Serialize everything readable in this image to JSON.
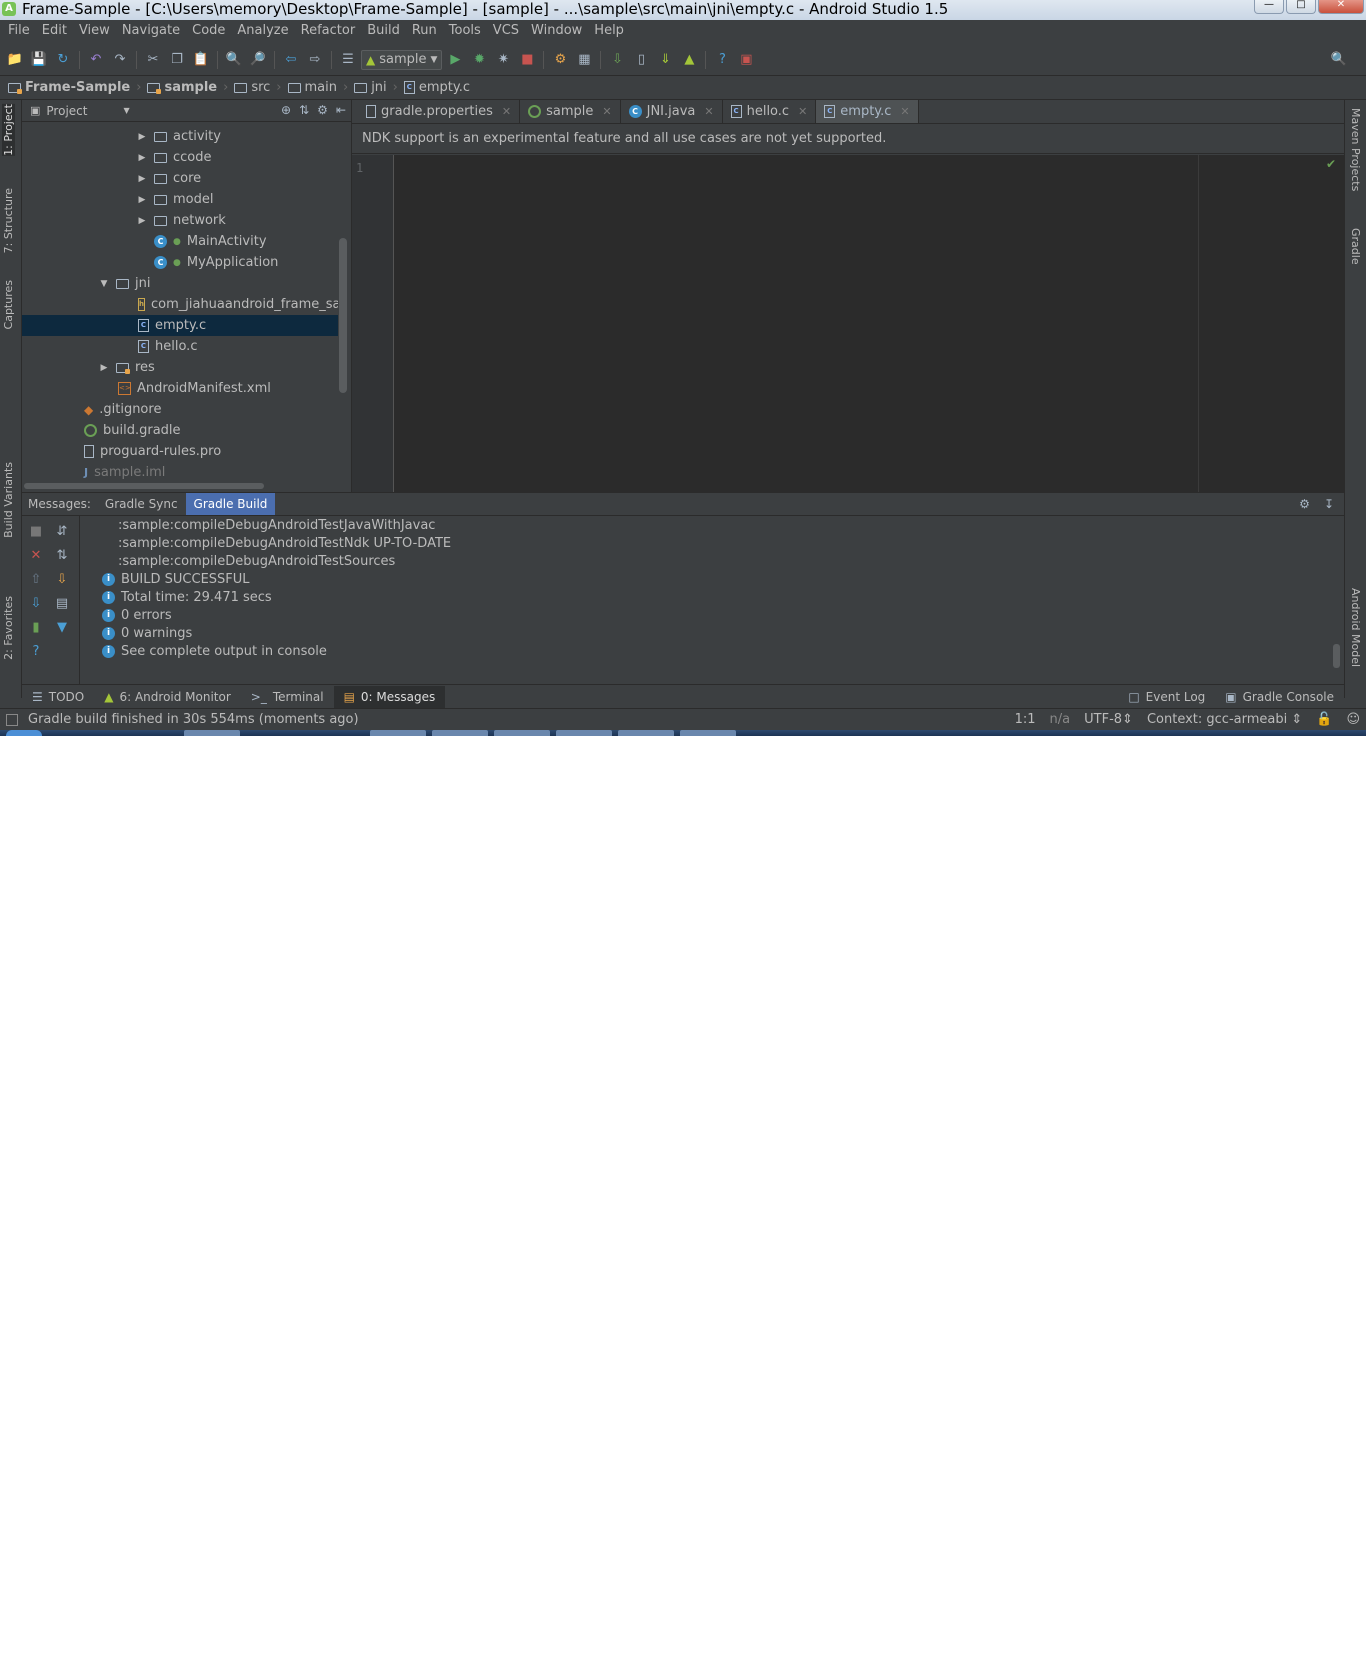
{
  "window": {
    "title": "Frame-Sample - [C:\\Users\\memory\\Desktop\\Frame-Sample] - [sample] - ...\\sample\\src\\main\\jni\\empty.c - Android Studio 1.5"
  },
  "menu": [
    {
      "label": "File"
    },
    {
      "label": "Edit"
    },
    {
      "label": "View"
    },
    {
      "label": "Navigate"
    },
    {
      "label": "Code"
    },
    {
      "label": "Analyze"
    },
    {
      "label": "Refactor"
    },
    {
      "label": "Build"
    },
    {
      "label": "Run"
    },
    {
      "label": "Tools"
    },
    {
      "label": "VCS"
    },
    {
      "label": "Window"
    },
    {
      "label": "Help"
    }
  ],
  "toolbar": {
    "run_config": "sample"
  },
  "breadcrumb": [
    {
      "label": "Frame-Sample"
    },
    {
      "label": "sample"
    },
    {
      "label": "src"
    },
    {
      "label": "main"
    },
    {
      "label": "jni"
    },
    {
      "label": "empty.c"
    }
  ],
  "left_strip": {
    "project": "1: Project",
    "structure": "7: Structure",
    "captures": "Captures",
    "build_variants": "Build Variants",
    "favorites": "2: Favorites"
  },
  "right_strip": {
    "maven": "Maven Projects",
    "gradle": "Gradle",
    "android_model": "Android Model"
  },
  "project_panel": {
    "view_label": "Project",
    "tree": [
      {
        "label": "activity"
      },
      {
        "label": "ccode"
      },
      {
        "label": "core"
      },
      {
        "label": "model"
      },
      {
        "label": "network"
      },
      {
        "label": "MainActivity"
      },
      {
        "label": "MyApplication"
      },
      {
        "label": "jni"
      },
      {
        "label": "com_jiahuaandroid_frame_sam"
      },
      {
        "label": "empty.c"
      },
      {
        "label": "hello.c"
      },
      {
        "label": "res"
      },
      {
        "label": "AndroidManifest.xml"
      },
      {
        "label": ".gitignore"
      },
      {
        "label": "build.gradle"
      },
      {
        "label": "proguard-rules.pro"
      },
      {
        "label": "sample.iml"
      }
    ]
  },
  "editor": {
    "tabs": [
      {
        "label": "gradle.properties"
      },
      {
        "label": "sample"
      },
      {
        "label": "JNI.java"
      },
      {
        "label": "hello.c"
      },
      {
        "label": "empty.c"
      }
    ],
    "notice": "NDK support is an experimental feature and all use cases are not yet supported.",
    "line_number": "1"
  },
  "messages": {
    "label": "Messages:",
    "tabs": [
      {
        "label": "Gradle Sync"
      },
      {
        "label": "Gradle Build"
      }
    ],
    "lines": [
      ":sample:compileDebugAndroidTestJavaWithJavac",
      ":sample:compileDebugAndroidTestNdk UP-TO-DATE",
      ":sample:compileDebugAndroidTestSources"
    ],
    "info_lines": [
      "BUILD SUCCESSFUL",
      "Total time: 29.471 secs",
      "0 errors",
      "0 warnings",
      "See complete output in console"
    ]
  },
  "tool_windows": {
    "todo": "TODO",
    "android_monitor": "6: Android Monitor",
    "terminal": "Terminal",
    "messages": "0: Messages",
    "event_log": "Event Log",
    "gradle_console": "Gradle Console"
  },
  "status": {
    "message": "Gradle build finished in 30s 554ms (moments ago)",
    "position": "1:1",
    "na": "n/a",
    "encoding": "UTF-8",
    "context": "Context: gcc-armeabi"
  }
}
